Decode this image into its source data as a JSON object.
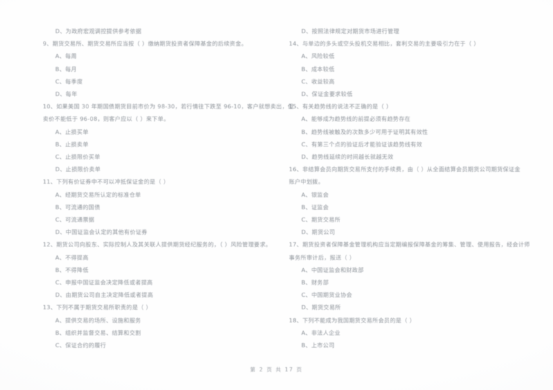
{
  "document": {
    "kind": "scanned-exam-paper",
    "subject_hint": "期货从业资格考试",
    "ink_color": "#8d939b",
    "paper_color": "#ffffff"
  },
  "footer": {
    "text": "第 2 页 共 17 页"
  },
  "left_column": {
    "orphan_option": {
      "label": "D、为政府宏观调控提供参考依据"
    },
    "questions": [
      {
        "number": "9",
        "stem": "9、期货交易所、期货交易所应当按（        ）缴纳期货投资者保障基金的后续资金。",
        "stem_line2": "",
        "options": [
          "A、每周",
          "B、每月",
          "C、每季度",
          "D、每年"
        ]
      },
      {
        "number": "10",
        "stem": "10、如果美国 30 年期国债期货目前市价为 98-30，若行情往下跌至 96-10，客户就想卖出，但",
        "stem_line2": "卖价不能低于 96-08，则客户应以（        ）来下单。",
        "options": [
          "A、止损买单",
          "B、止损卖单",
          "C、止损限价买单",
          "D、止损限价卖单"
        ]
      },
      {
        "number": "11",
        "stem": "11、下列有价证券中不可以冲抵保证金的是（        ）",
        "stem_line2": "",
        "options": [
          "A、经期货交易所认定的标准仓单",
          "B、可流通的国债",
          "C、可流通票据",
          "D、中国证监会认定的其他有价证券"
        ]
      },
      {
        "number": "12",
        "stem": "12、期货公司向股东、实际控制人及其关联人提供期货经纪服务的，（        ）风险管理要求。",
        "stem_line2": "",
        "options": [
          "A、不得提高",
          "B、不得降低",
          "C、申报中国证监会决定降低或者提高",
          "D、由期货公司自主决定降低或者提高"
        ]
      },
      {
        "number": "13",
        "stem": "13、下列不属于期货交易所职责的是（        ）",
        "stem_line2": "",
        "options": [
          "A、提供交易的场所、设施和服务",
          "B、组织并监督交易、结算和交割",
          "C、保证合约的履行"
        ]
      }
    ]
  },
  "right_column": {
    "orphan_option": {
      "label": "D、按照法律规定对期货市场进行管理"
    },
    "questions": [
      {
        "number": "14",
        "stem": "14、与单边的多头或空头投机交易相比，套利交易的主要吸引力在于（        ）",
        "stem_line2": "",
        "options": [
          "A、风险较低",
          "B、成本较低",
          "C、收益较高",
          "D、保证金要求较低"
        ]
      },
      {
        "number": "15",
        "stem": "15、有关趋势线的说法不正确的是（        ）",
        "stem_line2": "",
        "options": [
          "A、能够成为趋势线的前提必须有趋势存在",
          "B、趋势线被触及的次数多少可用于证明其有效性",
          "C、有第三个点的验证后才能验证该趋势线有效",
          "D、趋势线延续的时间越长就越无效"
        ]
      },
      {
        "number": "16",
        "stem": "16、非结算会员向期货交易所支付的手续费，由（        ）从全面结算会员期货公司期货保证金",
        "stem_line2": "账户中划拨。",
        "options": [
          "A、银监会",
          "B、证监会",
          "C、期货交易所",
          "D、期货公司"
        ]
      },
      {
        "number": "17",
        "stem": "17、期货投资者保障基金管理机构应当定期编报保障基金的筹集、管理、使用报告，经会计师",
        "stem_line2": "事务所审计后，报送（        ）",
        "options": [
          "A、中国证监会和财政部",
          "B、财务部",
          "C、中国期货业协会",
          "D、期货交易所"
        ]
      },
      {
        "number": "18",
        "stem": "18、下列不能成为我国期货交易所会员的是（        ）",
        "stem_line2": "",
        "options": [
          "A、非法人企业",
          "B、上市公司"
        ]
      }
    ]
  }
}
